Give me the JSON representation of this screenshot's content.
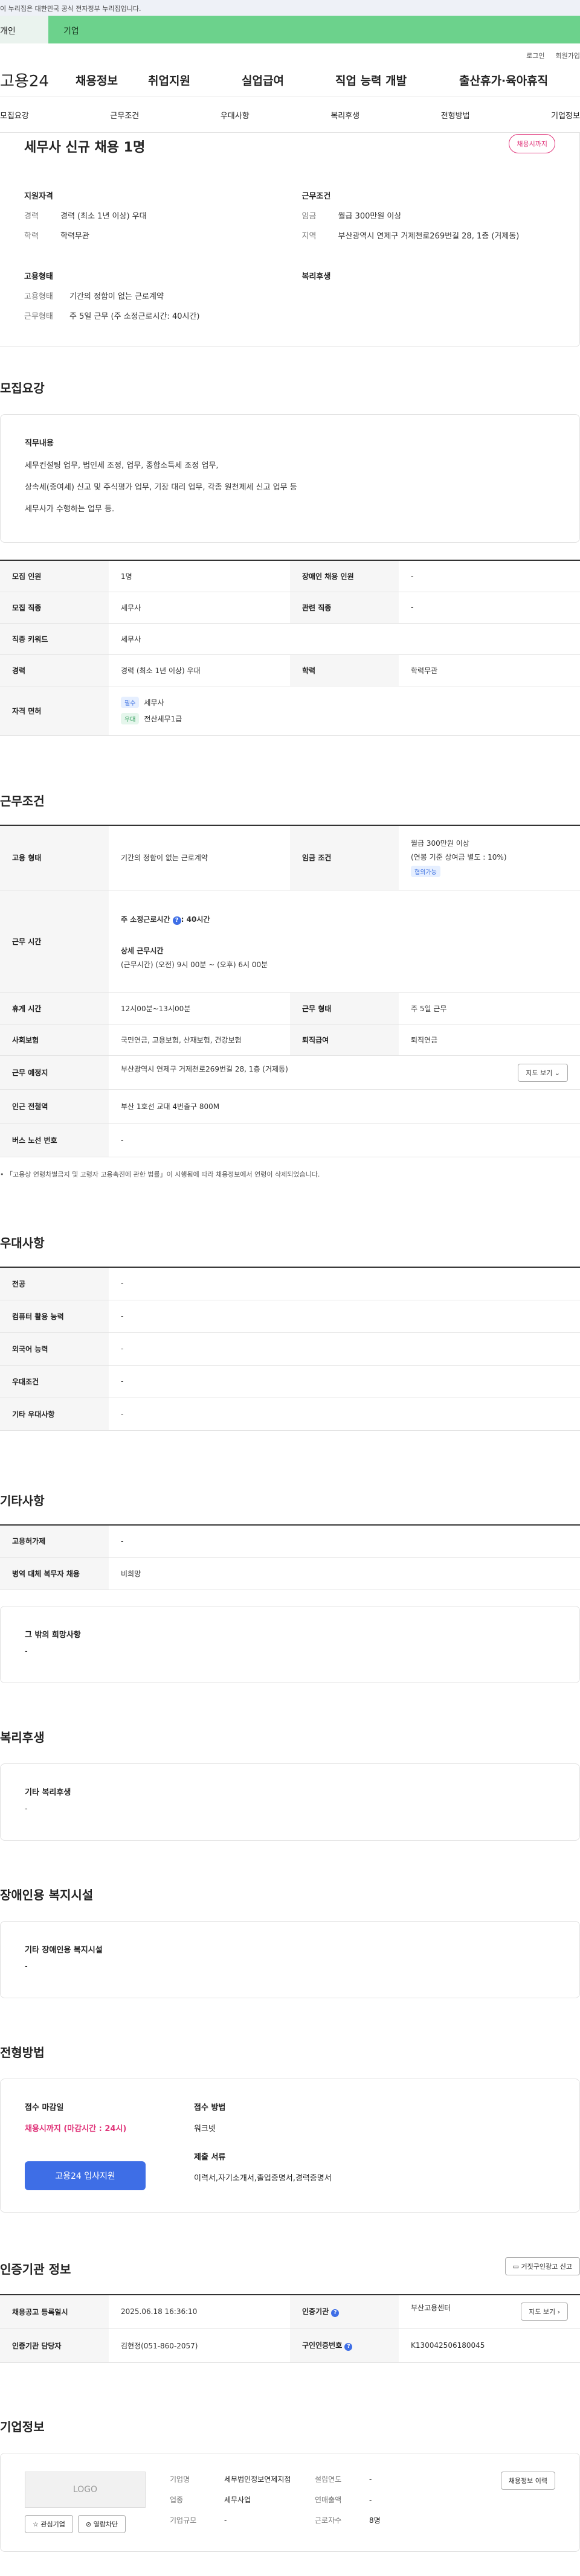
{
  "gov_banner": "이 누리집은 대한민국 공식 전자정부 누리집입니다.",
  "top_tabs": {
    "personal": "개인",
    "company": "기업"
  },
  "utility": {
    "login": "로그인",
    "signup": "회원가입"
  },
  "gnb": {
    "logo": "고용24",
    "menu": [
      "채용정보",
      "취업지원",
      "실업급여",
      "직업 능력 개발",
      "출산휴가·육아휴직"
    ]
  },
  "sub_tabs": [
    "모집요강",
    "근무조건",
    "우대사항",
    "복리후생",
    "전형방법",
    "기업정보"
  ],
  "summary": {
    "title": "세무사 신규 채용 1명",
    "badge": "채용시까지",
    "qualification": {
      "heading": "지원자격",
      "rows": [
        {
          "k": "경력",
          "v": "경력 (최소 1년 이상) 우대"
        },
        {
          "k": "학력",
          "v": "학력무관"
        }
      ]
    },
    "conditions": {
      "heading": "근무조건",
      "rows": [
        {
          "k": "임금",
          "v": "월급 300만원 이상"
        },
        {
          "k": "지역",
          "v": "부산광역시 연제구 거제천로269번길 28, 1층 (거제동)"
        }
      ]
    },
    "employment": {
      "heading": "고용형태",
      "rows": [
        {
          "k": "고용형태",
          "v": "기간의 정함이 없는 근로계약"
        },
        {
          "k": "근무형태",
          "v": "주 5일 근무 (주 소정근로시간: 40시간)"
        }
      ]
    },
    "welfare": {
      "heading": "복리후생"
    }
  },
  "recruit": {
    "title": "모집요강",
    "duty_heading": "직무내용",
    "duty_lines": [
      "세무컨설팅  업무, 법인세 조정, 업무,  종합소득세 조정 업무,",
      "상속세(증여세)  신고 및 주식평가 업무, 기장 대리 업무, 각종 원천제세 신고 업무 등",
      "세무사가 수행하는 업무 등."
    ],
    "rows": {
      "count_label": "모집 인원",
      "count": "1명",
      "disabled_label": "장애인 채용 인원",
      "disabled": "-",
      "job_label": "모집 직종",
      "job": "세무사",
      "related_label": "관련 직종",
      "related": "-",
      "keyword_label": "직종 키워드",
      "keyword": "세무사",
      "career_label": "경력",
      "career": "경력 (최소 1년 이상) 우대",
      "edu_label": "학력",
      "edu": "학력무관",
      "license_label": "자격 면허",
      "licenses": [
        {
          "tag": "필수",
          "name": "세무사"
        },
        {
          "tag": "우대",
          "name": "전산세무1급"
        }
      ]
    }
  },
  "work": {
    "title": "근무조건",
    "type_label": "고용 형태",
    "type": "기간의 정함이 없는 근로계약",
    "wage_label": "임금 조건",
    "wage": "월급 300만원 이상",
    "wage_sub": "(연봉 기준 상여금 별도 : 10%)",
    "wage_tag": "협의가능",
    "hours_label": "근무 시간",
    "hours_weekly": "주 소정근로시간",
    "hours_weekly_value": ": 40시간",
    "hours_detail_heading": "상세 근무시간",
    "hours_detail": "(근무시간) (오전) 9시 00분 ~ (오후) 6시 00분",
    "break_label": "휴게 시간",
    "break": "12시00분~13시00분",
    "shift_label": "근무 형태",
    "shift": "주 5일 근무",
    "insurance_label": "사회보험",
    "insurance": "국민연금, 고용보험, 산재보험, 건강보험",
    "retire_label": "퇴직급여",
    "retire": "퇴직연금",
    "place_label": "근무 예정지",
    "place": "부산광역시 연제구 거제천로269번길 28, 1층 (거제동)",
    "map_btn": "지도 보기",
    "subway_label": "인근 전철역",
    "subway": "부산 1호선 교대 4번출구 800M",
    "bus_label": "버스 노선 번호",
    "bus": "-",
    "note": "「고용상 연령차별금지 및 고령자 고용촉진에 관한 법률」이 시행됨에 따라 채용정보에서 연령이 삭제되었습니다."
  },
  "prefer": {
    "title": "우대사항",
    "rows": [
      {
        "k": "전공",
        "v": "-"
      },
      {
        "k": "컴퓨터 활용 능력",
        "v": "-"
      },
      {
        "k": "외국어 능력",
        "v": "-"
      },
      {
        "k": "우대조건",
        "v": "-"
      },
      {
        "k": "기타 우대사항",
        "v": "-"
      }
    ]
  },
  "etc": {
    "title": "기타사항",
    "rows": [
      {
        "k": "고용허가제",
        "v": "-"
      },
      {
        "k": "병역 대체 복무자 채용",
        "v": "비희망"
      }
    ],
    "hope_heading": "그 밖의 희망사항",
    "hope": "-"
  },
  "welfare": {
    "title": "복리후생",
    "heading": "기타 복리후생",
    "value": "-"
  },
  "facility": {
    "title": "장애인용 복지시설",
    "heading": "기타 장애인용 복지시설",
    "value": "-"
  },
  "process": {
    "title": "전형방법",
    "deadline_label": "접수 마감일",
    "deadline": "채용시까지 (마감시간 : 24시)",
    "apply_btn": "고용24 입사지원",
    "method_label": "접수 방법",
    "method": "워크넷",
    "docs_label": "제출 서류",
    "docs": "이력서,자기소개서,졸업증명서,경력증명서"
  },
  "agency": {
    "title": "인증기관 정보",
    "report_btn": "거짓구인광고 신고",
    "reg_label": "채용공고 등록일시",
    "reg": "2025.06.18 16:36:10",
    "org_label": "인증기관",
    "org": "부산고용센터",
    "detail_btn": "지도 보기",
    "manager_label": "인증기관 담당자",
    "manager": "김현정(051-860-2057)",
    "auth_label": "구인인증번호",
    "auth": "K130042506180045"
  },
  "company": {
    "title": "기업정보",
    "logo": "LOGO",
    "fav_btn": "관심기업",
    "block_btn": "열람차단",
    "name_label": "기업명",
    "name": "세무법인정보연제지점",
    "industry_label": "업종",
    "industry": "세무사업",
    "size_label": "기업규모",
    "size": "-",
    "founded_label": "설립연도",
    "founded": "-",
    "sales_label": "연매출액",
    "sales": "-",
    "employees_label": "근로자수",
    "employees": "8명",
    "history_btn": "채용정보 이력"
  },
  "colors": {
    "accent": "#3e6ee6",
    "company_tab": "#6cd28c",
    "deadline": "#e0357a"
  }
}
